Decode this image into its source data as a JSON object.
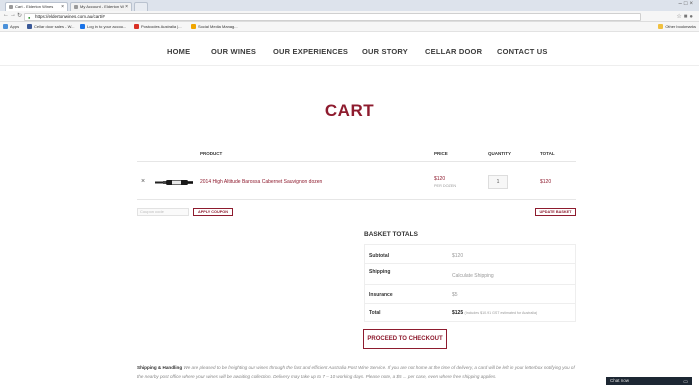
{
  "browser": {
    "tabs": [
      {
        "label": "Cart - Elderton Wines"
      },
      {
        "label": "My Account - Elderton W"
      }
    ],
    "url": "https://eldertonwines.com.au/cart/#",
    "bookmarks": [
      {
        "label": "Apps",
        "color": "#4a90d9"
      },
      {
        "label": "Cellar door sales - W...",
        "color": "#3b5998"
      },
      {
        "label": "Log in to your accou...",
        "color": "#1a73e8"
      },
      {
        "label": "Postcodes Australia |...",
        "color": "#d93025"
      },
      {
        "label": "Social Media Manag...",
        "color": "#f0a500"
      }
    ],
    "other_bookmarks": "Other bookmarks"
  },
  "nav": {
    "items": [
      {
        "label": "HOME"
      },
      {
        "label": "OUR WINES"
      },
      {
        "label": "OUR EXPERIENCES"
      },
      {
        "label": "OUR STORY"
      },
      {
        "label": "CELLAR DOOR"
      },
      {
        "label": "CONTACT US"
      }
    ]
  },
  "cart": {
    "title": "CART",
    "headers": {
      "product": "PRODUCT",
      "price": "PRICE",
      "quantity": "QUANTITY",
      "total": "TOTAL"
    },
    "item": {
      "remove": "×",
      "name": "2014 High Altitude Barossa Cabernet Sauvignon dozen",
      "price": "$120",
      "per": "PER DOZEN",
      "quantity": "1",
      "total": "$120"
    },
    "coupon_placeholder": "Coupon code",
    "apply_label": "APPLY COUPON",
    "update_label": "UPDATE BASKET"
  },
  "totals": {
    "title": "BASKET TOTALS",
    "subtotal_label": "Subtotal",
    "subtotal_value": "$120",
    "shipping_label": "Shipping",
    "shipping_value": "Calculate Shipping",
    "insurance_label": "Insurance",
    "insurance_value": "$5",
    "total_label": "Total",
    "total_value": "$125",
    "total_note": "(Includes $10.91 GST estimated for Australia)",
    "checkout_label": "PROCEED TO CHECKOUT"
  },
  "shipping_info": {
    "heading": "Shipping & Handling",
    "text": " We are pleased to be freighting our wines through the fast and efficient Australia Post Wine Service. If you are not home at the time of delivery, a card will be left in your letterbox notifying you of the nearby post office where your wines will be awaiting collection. Delivery may take up to 7 – 10 working days. Please note, a $5 ... per case, even where free shipping applies."
  },
  "taskbar": {
    "label": "Chat now"
  },
  "colors": {
    "brand": "#8e1b2e"
  }
}
